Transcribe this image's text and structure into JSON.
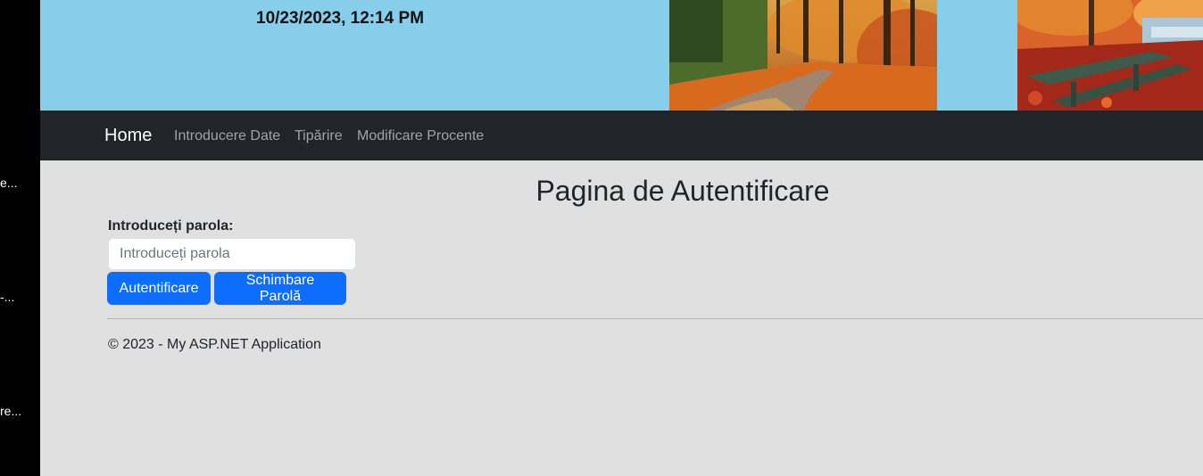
{
  "left_strip": {
    "fragments": [
      "e...",
      "-...",
      "re..."
    ]
  },
  "header": {
    "datetime": "10/23/2023, 12:14 PM",
    "images": [
      "autumn-forest-path-image",
      "autumn-park-bench-image"
    ]
  },
  "navbar": {
    "brand": "Home",
    "links": [
      "Introducere Date",
      "Tipărire",
      "Modificare Procente"
    ]
  },
  "main": {
    "title": "Pagina de Autentificare",
    "password_label": "Introduceți parola:",
    "password_placeholder": "Introduceți parola",
    "password_value": "",
    "login_button": "Autentificare",
    "change_password_button": "Schimbare Parolă"
  },
  "footer": {
    "text": "© 2023 - My ASP.NET Application"
  },
  "colors": {
    "header_bg": "#87ceeb",
    "navbar_bg": "#212529",
    "page_bg": "#e0e0e0",
    "button_bg": "#0d6efd"
  }
}
